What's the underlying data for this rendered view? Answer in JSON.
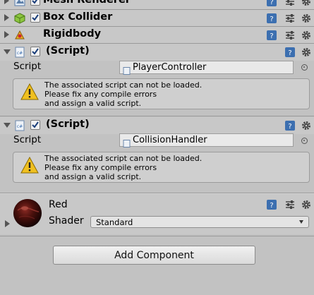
{
  "components": [
    {
      "id": "mesh_renderer",
      "title": "Mesh Renderer",
      "icon": "mesh-renderer-icon",
      "has_checkbox": true,
      "checked": true,
      "expanded": false
    },
    {
      "id": "box_collider",
      "title": "Box Collider",
      "icon": "box-collider-icon",
      "has_checkbox": true,
      "checked": true,
      "expanded": false
    },
    {
      "id": "rigidbody",
      "title": "Rigidbody",
      "icon": "rigidbody-icon",
      "has_checkbox": false,
      "expanded": false
    },
    {
      "id": "script1",
      "title": "(Script)",
      "icon": "script-icon",
      "has_checkbox": true,
      "checked": true,
      "expanded": true,
      "property_label": "Script",
      "script_value": "PlayerController",
      "warning": [
        "The associated script can not be loaded.",
        "Please fix any compile errors",
        "and assign a valid script."
      ]
    },
    {
      "id": "script2",
      "title": "(Script)",
      "icon": "script-icon",
      "has_checkbox": true,
      "checked": true,
      "expanded": true,
      "property_label": "Script",
      "script_value": "CollisionHandler",
      "warning": [
        "The associated script can not be loaded.",
        "Please fix any compile errors",
        "and assign a valid script."
      ]
    }
  ],
  "material": {
    "name": "Red",
    "shader_label": "Shader",
    "shader_value": "Standard"
  },
  "add_component_label": "Add Component",
  "colors": {
    "background": "#c2c2c2",
    "header": "#c8c8c8",
    "warning_yellow": "#f0c020",
    "help_blue": "#3c6fb0"
  }
}
